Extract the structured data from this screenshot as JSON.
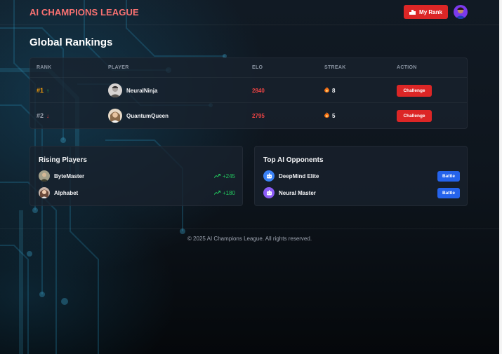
{
  "app": {
    "logo_text": "AI CHAMPIONS LEAGUE",
    "my_rank_label": "My Rank"
  },
  "page": {
    "title": "Global Rankings"
  },
  "rankings": {
    "columns": [
      "RANK",
      "PLAYER",
      "ELO",
      "STREAK",
      "ACTION"
    ],
    "rows": [
      {
        "rank": "#1",
        "trend": "up",
        "trend_icon": "↑",
        "player": "NeuralNinja",
        "elo": "2840",
        "streak": "8",
        "action": "Challenge"
      },
      {
        "rank": "#2",
        "trend": "down",
        "trend_icon": "↓",
        "player": "QuantumQueen",
        "elo": "2795",
        "streak": "5",
        "action": "Challenge"
      }
    ]
  },
  "rising": {
    "title": "Rising Players",
    "items": [
      {
        "name": "ByteMaster",
        "gain": "+245"
      },
      {
        "name": "Alphabet",
        "gain": "+180"
      }
    ]
  },
  "opponents": {
    "title": "Top AI Opponents",
    "items": [
      {
        "name": "DeepMind Elite",
        "action": "Battle",
        "icon_color": "#3b82f6"
      },
      {
        "name": "Neural Master",
        "action": "Battle",
        "icon_color": "#8b5cf6"
      }
    ]
  },
  "footer": {
    "text": "© 2025 AI Champions League. All rights reserved."
  },
  "colors": {
    "accent_red": "#dc2626",
    "elo_red": "#ef4444",
    "rank_gold": "#f59e0b",
    "up_green": "#22c55e",
    "battle_blue": "#2563eb"
  }
}
